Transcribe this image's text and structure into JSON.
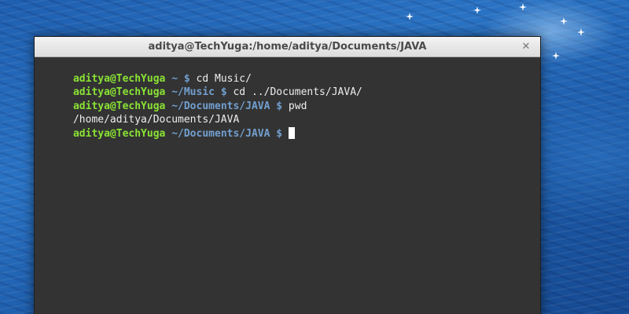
{
  "window": {
    "title": "aditya@TechYuga:/home/aditya/Documents/JAVA",
    "close_icon": "close-icon",
    "close_glyph": "✕"
  },
  "terminal": {
    "lines": [
      {
        "user": "aditya@TechYuga",
        "path": " ~ $",
        "command": " cd Music/"
      },
      {
        "user": "aditya@TechYuga",
        "path": " ~/Music $",
        "command": " cd ../Documents/JAVA/"
      },
      {
        "user": "aditya@TechYuga",
        "path": " ~/Documents/JAVA $",
        "command": " pwd"
      },
      {
        "output": "/home/aditya/Documents/JAVA"
      },
      {
        "user": "aditya@TechYuga",
        "path": " ~/Documents/JAVA $",
        "command": " "
      }
    ]
  },
  "colors": {
    "user_prompt": "#8ae234",
    "path_prompt": "#729fcf",
    "terminal_bg": "#333333",
    "desktop_bg": "#2a73c4"
  }
}
